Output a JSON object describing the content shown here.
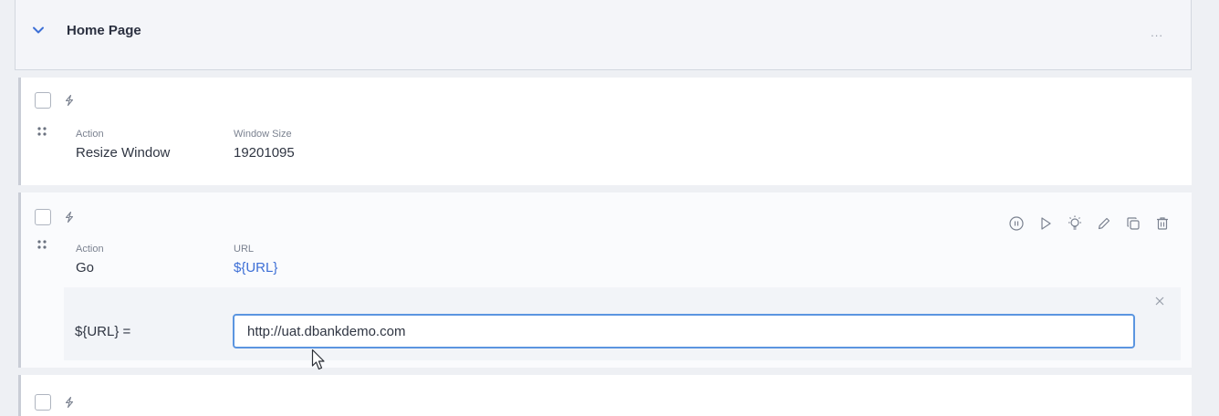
{
  "section": {
    "title": "Home Page",
    "more_label": "...",
    "icons": {
      "collapse": "chevron-down-icon",
      "more": "more-horizontal-icon"
    }
  },
  "steps": [
    {
      "action_label": "Action",
      "action_value": "Resize Window",
      "param_label": "Window Size",
      "param_value": "19201095"
    },
    {
      "action_label": "Action",
      "action_value": "Go",
      "param_label": "URL",
      "param_value": "${URL}",
      "toolbar_icons": [
        "pause-icon",
        "play-icon",
        "bulb-icon",
        "edit-icon",
        "copy-icon",
        "delete-icon"
      ],
      "variable": {
        "name": "${URL} =",
        "value": "http://uat.dbankdemo.com"
      }
    },
    {}
  ],
  "colors": {
    "accent": "#3d6fd6",
    "input_focus_border": "#5b95e0",
    "step_border": "#c9cdd6",
    "header_bg": "#f4f5f9"
  }
}
